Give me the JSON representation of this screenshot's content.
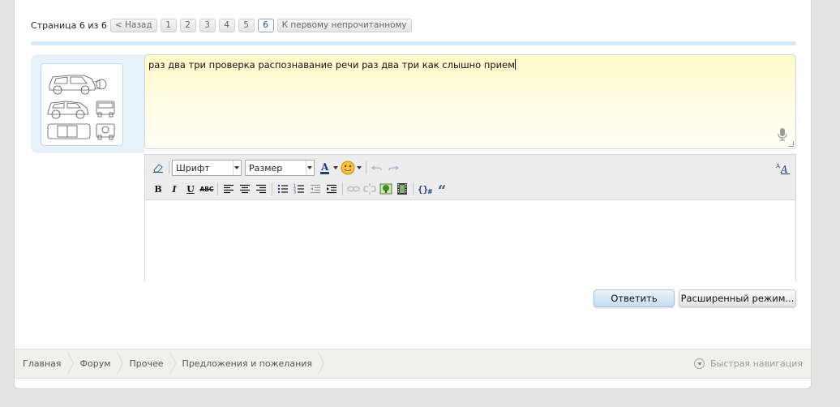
{
  "pagination": {
    "label": "Страница 6 из 6",
    "prev": "< Назад",
    "pages": [
      "1",
      "2",
      "3",
      "4",
      "5",
      "6"
    ],
    "current_page": "6",
    "first_unread": "К первому непрочитанному"
  },
  "avatar": {
    "icon": "car-blueprint-avatar"
  },
  "quick_reply": {
    "text": "раз два три проверка распознавание речи раз два три как слышно прием",
    "mic_icon": "microphone-icon"
  },
  "editor": {
    "font_select": "Шрифт",
    "size_select": "Размер",
    "bold": "B",
    "italic": "I",
    "underline": "U",
    "strike": "ABC"
  },
  "buttons": {
    "reply": "Ответить",
    "advanced": "Расширенный режим..."
  },
  "breadcrumb": [
    "Главная",
    "Форум",
    "Прочее",
    "Предложения и пожелания"
  ],
  "quick_nav": "Быстрая навигация",
  "colors": {
    "accent_blue": "#d5e8f6",
    "textarea_yellow": "#fffac8",
    "reply_button": "#c6dcef"
  }
}
